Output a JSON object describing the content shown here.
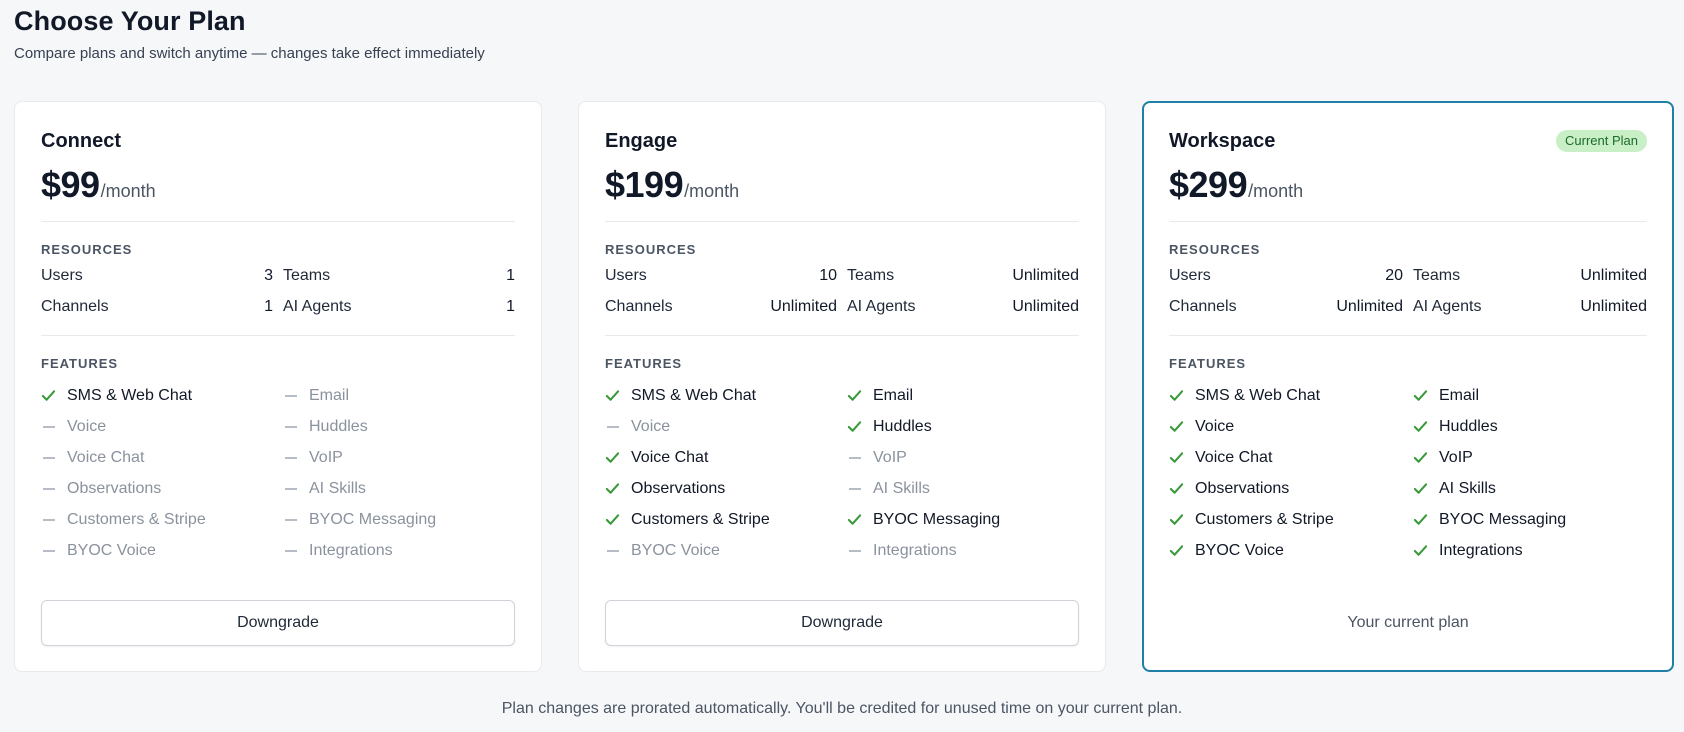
{
  "header": {
    "title": "Choose Your Plan",
    "subtitle": "Compare plans and switch anytime — changes take effect immediately"
  },
  "labels": {
    "resources": "RESOURCES",
    "features": "FEATURES",
    "users": "Users",
    "teams": "Teams",
    "channels": "Channels",
    "ai_agents": "AI Agents"
  },
  "plans": [
    {
      "name": "Connect",
      "price": "$99",
      "period": "/month",
      "resources": {
        "users": "3",
        "teams": "1",
        "channels": "1",
        "ai_agents": "1"
      },
      "features_left": [
        {
          "label": "SMS & Web Chat",
          "included": true
        },
        {
          "label": "Voice",
          "included": false
        },
        {
          "label": "Voice Chat",
          "included": false
        },
        {
          "label": "Observations",
          "included": false
        },
        {
          "label": "Customers & Stripe",
          "included": false
        },
        {
          "label": "BYOC Voice",
          "included": false
        }
      ],
      "features_right": [
        {
          "label": "Email",
          "included": false
        },
        {
          "label": "Huddles",
          "included": false
        },
        {
          "label": "VoIP",
          "included": false
        },
        {
          "label": "AI Skills",
          "included": false
        },
        {
          "label": "BYOC Messaging",
          "included": false
        },
        {
          "label": "Integrations",
          "included": false
        }
      ],
      "action_label": "Downgrade"
    },
    {
      "name": "Engage",
      "price": "$199",
      "period": "/month",
      "resources": {
        "users": "10",
        "teams": "Unlimited",
        "channels": "Unlimited",
        "ai_agents": "Unlimited"
      },
      "features_left": [
        {
          "label": "SMS & Web Chat",
          "included": true
        },
        {
          "label": "Voice",
          "included": false
        },
        {
          "label": "Voice Chat",
          "included": true
        },
        {
          "label": "Observations",
          "included": true
        },
        {
          "label": "Customers & Stripe",
          "included": true
        },
        {
          "label": "BYOC Voice",
          "included": false
        }
      ],
      "features_right": [
        {
          "label": "Email",
          "included": true
        },
        {
          "label": "Huddles",
          "included": true
        },
        {
          "label": "VoIP",
          "included": false
        },
        {
          "label": "AI Skills",
          "included": false
        },
        {
          "label": "BYOC Messaging",
          "included": true
        },
        {
          "label": "Integrations",
          "included": false
        }
      ],
      "action_label": "Downgrade"
    },
    {
      "name": "Workspace",
      "price": "$299",
      "period": "/month",
      "badge": "Current Plan",
      "resources": {
        "users": "20",
        "teams": "Unlimited",
        "channels": "Unlimited",
        "ai_agents": "Unlimited"
      },
      "features_left": [
        {
          "label": "SMS & Web Chat",
          "included": true
        },
        {
          "label": "Voice",
          "included": true
        },
        {
          "label": "Voice Chat",
          "included": true
        },
        {
          "label": "Observations",
          "included": true
        },
        {
          "label": "Customers & Stripe",
          "included": true
        },
        {
          "label": "BYOC Voice",
          "included": true
        }
      ],
      "features_right": [
        {
          "label": "Email",
          "included": true
        },
        {
          "label": "Huddles",
          "included": true
        },
        {
          "label": "VoIP",
          "included": true
        },
        {
          "label": "AI Skills",
          "included": true
        },
        {
          "label": "BYOC Messaging",
          "included": true
        },
        {
          "label": "Integrations",
          "included": true
        }
      ],
      "current_label": "Your current plan"
    }
  ],
  "footer": {
    "note": "Plan changes are prorated automatically. You'll be credited for unused time on your current plan."
  },
  "colors": {
    "check": "#3a9a3a",
    "current_border": "#1f7fa6",
    "badge_bg": "#c9efc7"
  }
}
